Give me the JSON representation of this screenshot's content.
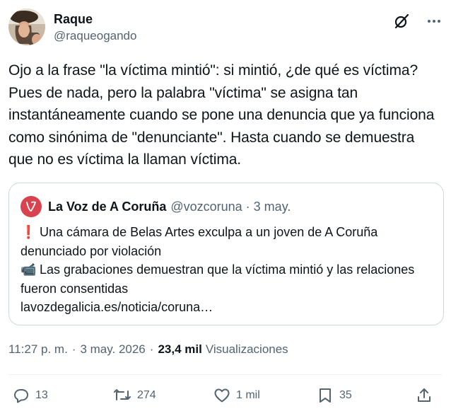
{
  "author": {
    "display_name": "Raque",
    "handle": "@raqueogando"
  },
  "header_icons": [
    "grok-icon",
    "more-icon"
  ],
  "tweet": {
    "text": "Ojo a la frase \"la víctima mintió\": si mintió, ¿de qué es víctima? Pues de nada, pero la palabra \"víctima\" se asigna tan instantáneamente cuando se pone una denuncia que ya funciona como sinónima de \"denunciante\". Hasta cuando se demuestra que no es víctima la llaman víctima."
  },
  "quote": {
    "name": "La Voz de A Coruña",
    "handle": "@vozcoruna",
    "separator": "·",
    "date": "3 may.",
    "line1_emoji": "❗",
    "line1": "Una cámara de Belas Artes exculpa a un joven de A Coruña denunciado por violación",
    "line2_emoji": "📹",
    "line2": "Las grabaciones demuestran que la víctima mintió y las relaciones fueron consentidas",
    "link": "lavozdegalicia.es/noticia/coruna…",
    "logo_color": "#d9434f"
  },
  "meta": {
    "time": "11:27 p. m.",
    "separator": "·",
    "date": "3 may. 2026",
    "separator2": "·",
    "views_count": "23,4 mil",
    "views_label": "Visualizaciones"
  },
  "actions": {
    "replies": "13",
    "reposts": "274",
    "likes": "1 mil",
    "bookmarks": "35"
  },
  "colors": {
    "text": "#0f1419",
    "secondary": "#536471",
    "border": "#cfd9de"
  }
}
